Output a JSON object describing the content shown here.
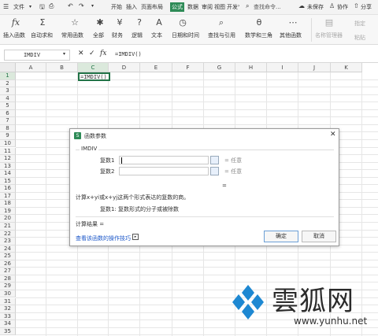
{
  "menubar": {
    "file": "文件",
    "tabs": [
      "开始",
      "插入",
      "页面布局",
      "公式",
      "数据",
      "审阅",
      "视图",
      "开发"
    ],
    "active_tab_index": 3,
    "search_placeholder": "查找命令...",
    "unsaved": "未保存",
    "collab": "协作",
    "share": "分享"
  },
  "ribbon": {
    "items": [
      {
        "label": "插入函数",
        "icon": "fx"
      },
      {
        "label": "自动求和",
        "icon": "Σ"
      },
      {
        "label": "常用函数",
        "icon": "☆"
      },
      {
        "label": "全部",
        "icon": "✱"
      },
      {
        "label": "财务",
        "icon": "¥"
      },
      {
        "label": "逻辑",
        "icon": "?"
      },
      {
        "label": "文本",
        "icon": "A"
      },
      {
        "label": "日期和时间",
        "icon": "◷"
      },
      {
        "label": "查找与引用",
        "icon": "⌕"
      },
      {
        "label": "数学和三角",
        "icon": "θ"
      },
      {
        "label": "其他函数",
        "icon": "⋯"
      },
      {
        "label": "名称管理器",
        "icon": "▤"
      }
    ],
    "side_labels": [
      "指定",
      "粘贴"
    ]
  },
  "formulabar": {
    "name_box": "IMDIV",
    "formula": "=IMDIV()"
  },
  "grid": {
    "columns": [
      "A",
      "B",
      "C",
      "D",
      "E",
      "F",
      "G",
      "H",
      "I",
      "J",
      "K"
    ],
    "rows": [
      "1",
      "2",
      "3",
      "4",
      "5",
      "6",
      "7",
      "8",
      "9",
      "10",
      "11",
      "12",
      "13",
      "14",
      "15",
      "16",
      "17",
      "18",
      "19",
      "20",
      "21",
      "22",
      "23",
      "24",
      "25",
      "26",
      "27",
      "28",
      "29",
      "30",
      "31",
      "32",
      "33",
      "34",
      "35"
    ],
    "active_cell_text": "=IMDIV()"
  },
  "dialog": {
    "title": "函数参数",
    "function_name": "IMDIV",
    "arg1_label": "复数1",
    "arg1_value": "",
    "arg1_result": "= 任意",
    "arg2_label": "复数2",
    "arg2_value": "",
    "arg2_result": "= 任意",
    "total_eq": "=",
    "description": "计算x+yi或x+yj这两个形式表达的复数的商。",
    "param_desc": "复数1:  复数形式的分子或被除数",
    "result_label": "计算结果 =",
    "help_link": "查看该函数的操作技巧",
    "ok": "确定",
    "cancel": "取消"
  },
  "watermark": {
    "brand": "雲狐网",
    "url": "www.yunhu.net"
  },
  "colors": {
    "accent_green": "#2e8b57",
    "active_cell_border": "#217346",
    "watermark_blue": "#1e88d2"
  }
}
